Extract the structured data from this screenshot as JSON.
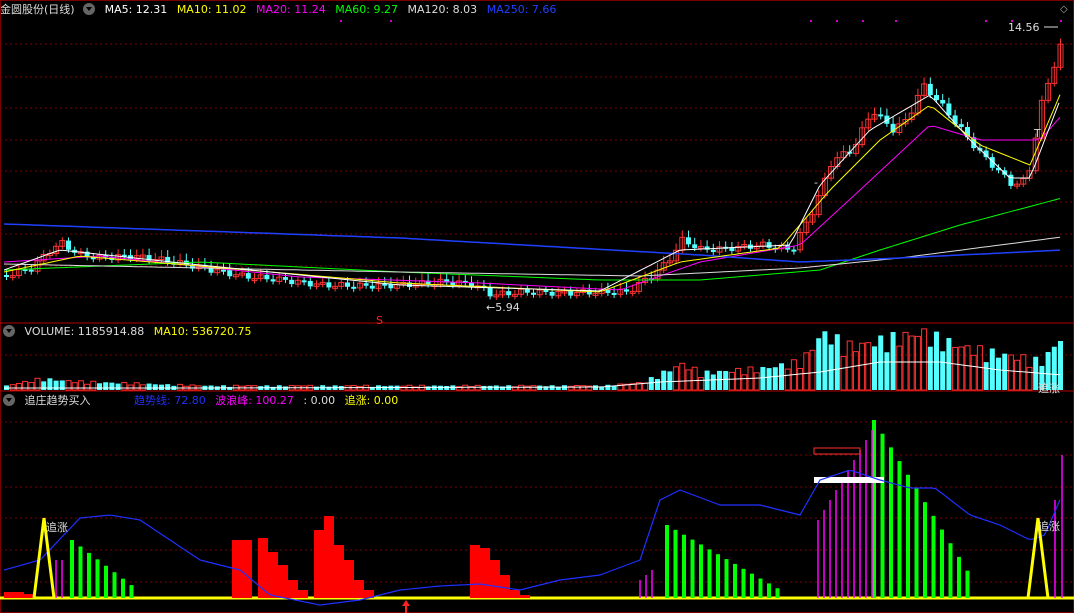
{
  "price_panel": {
    "title": "金圆股份(日线)",
    "ma": [
      {
        "label": "MA5: 12.31",
        "color": "#ffffff"
      },
      {
        "label": "MA10: 11.02",
        "color": "#ffff00"
      },
      {
        "label": "MA20: 11.24",
        "color": "#ff00ff"
      },
      {
        "label": "MA60: 9.27",
        "color": "#00ff00"
      },
      {
        "label": "MA120: 8.03",
        "color": "#dddddd"
      },
      {
        "label": "MA250: 7.66",
        "color": "#2040ff"
      }
    ],
    "high_label": "14.56",
    "low_label": "5.94",
    "marker_s": "S",
    "marker_t": "T"
  },
  "volume_panel": {
    "label": "VOLUME: 1185914.88",
    "ma10_label": "MA10: 536720.75",
    "tag": "追涨"
  },
  "indicator_panel": {
    "name": "追庄趋势买入",
    "trend_label": "趋势线: 72.80",
    "wave_label": "波浪峰: 100.27",
    "zero_label": ": 0.00",
    "chase_label": "追涨: 0.00",
    "tag_left": "追涨",
    "tag_right": "追涨"
  },
  "colors": {
    "up": "#ff3232",
    "down": "#54ffff",
    "grid": "#7a0000",
    "trend_line": "#2030ff",
    "wave": "#ff00ff",
    "green_bar": "#00ff00",
    "red_block": "#ff0000",
    "chase": "#ffff00"
  },
  "chart_data": {
    "type": "candlestick",
    "price_range": {
      "high": 14.56,
      "low": 5.94
    },
    "volume": {
      "value": 1185914.88,
      "ma10": 536720.75
    },
    "indicator": {
      "trend": 72.8,
      "wave_peak": 100.27,
      "chase": 0.0
    }
  }
}
